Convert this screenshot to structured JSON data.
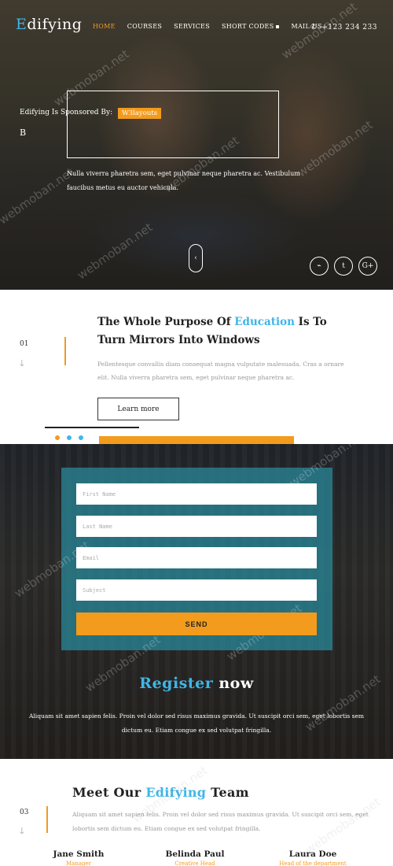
{
  "header": {
    "logo_first": "E",
    "logo_rest": "difying",
    "nav": [
      "HOME",
      "COURSES",
      "SERVICES",
      "SHORT CODES",
      "MAIL US"
    ],
    "phone": "+123 234 233"
  },
  "hero": {
    "sponsor_text": "Edifying Is Sponsored By:",
    "sponsor_tag": "W3layouts",
    "sponsor_letter": "B",
    "description": "Nulla viverra pharetra sem, eget pulvinar neque pharetra ac. Vestibulum faucibus metus eu auctor vehicula.",
    "scroll_icon": "chevron-left",
    "socials": [
      {
        "icon": "link-icon",
        "glyph": "⌁"
      },
      {
        "icon": "twitter-icon",
        "glyph": "t"
      },
      {
        "icon": "google-plus-icon",
        "glyph": "G+"
      }
    ]
  },
  "about": {
    "number": "01",
    "title_pre": "The Whole Purpose Of ",
    "title_hl": "Education",
    "title_post": " Is To Turn Mirrors Into Windows",
    "text": "Pellentesque convallis diam consequat magna vulputate malesuada. Cras a ornare elit. Nulla viverra pharetra sem, eget pulvinar neque pharetra ac.",
    "button": "Learn more"
  },
  "register": {
    "fields": {
      "first_name": "First Name",
      "last_name": "Last Name",
      "email": "Email",
      "subject": "Subject"
    },
    "send": "SEND",
    "title_hl": "Register",
    "title_rest": " now",
    "text": "Aliquam sit amet sapien felis. Proin vel dolor sed risus maximus gravida. Ut suscipit orci sem, eget lobortis sem dictum eu. Etiam congue ex sed volutpat fringilla."
  },
  "team": {
    "title_pre": "Meet Our ",
    "title_hl": "Edifying",
    "title_post": " Team",
    "number": "03",
    "text": "Aliquam sit amet sapien felis. Proin vel dolor sed risus maximus gravida. Ut suscipit orci sem, eget lobortis sem dictum eu. Etiam congue ex sed volutpat fringilla.",
    "members": [
      {
        "name": "Jane Smith",
        "role": "Manager"
      },
      {
        "name": "Belinda Paul",
        "role": "Creative Head"
      },
      {
        "name": "Laura Doe",
        "role": "Head of the department"
      }
    ]
  },
  "watermark": "webmoban.net",
  "colors": {
    "accent_orange": "#f29b1d",
    "accent_blue": "#3fb6e8",
    "form_panel": "#2a8ca0"
  }
}
